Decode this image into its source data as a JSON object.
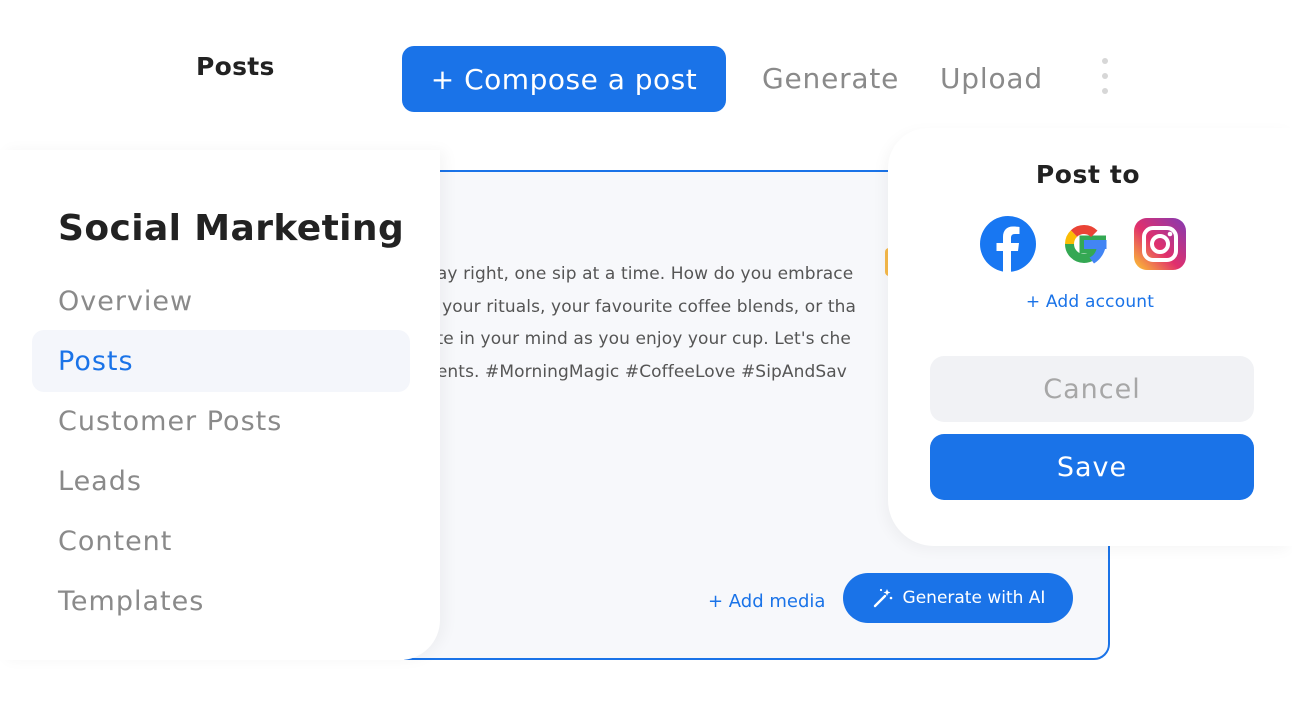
{
  "header": {
    "title": "Posts",
    "compose_label": "+ Compose a post",
    "generate_label": "Generate",
    "upload_label": "Upload"
  },
  "sidebar": {
    "title": "Social Marketing",
    "items": [
      {
        "label": "Overview"
      },
      {
        "label": "Posts",
        "active": true
      },
      {
        "label": "Customer Posts"
      },
      {
        "label": "Leads"
      },
      {
        "label": "Content"
      },
      {
        "label": "Templates"
      }
    ]
  },
  "editor": {
    "lines": [
      "day right, one sip at a time. How do you embrace",
      "e your rituals, your favourite coffee blends, or tha",
      "ate in your mind as you enjoy your cup. Let's che",
      "nents. #MorningMagic #CoffeeLove #SipAndSav"
    ],
    "add_media_label": "+ Add media",
    "generate_ai_label": "Generate with AI"
  },
  "post_panel": {
    "title": "Post to",
    "accounts": [
      "facebook-icon",
      "google-icon",
      "instagram-icon"
    ],
    "add_account_label": "+ Add account",
    "cancel_label": "Cancel",
    "save_label": "Save"
  },
  "colors": {
    "accent": "#1a73e8",
    "muted_text": "#8a8a8a",
    "active_bg": "#f4f6fb"
  }
}
